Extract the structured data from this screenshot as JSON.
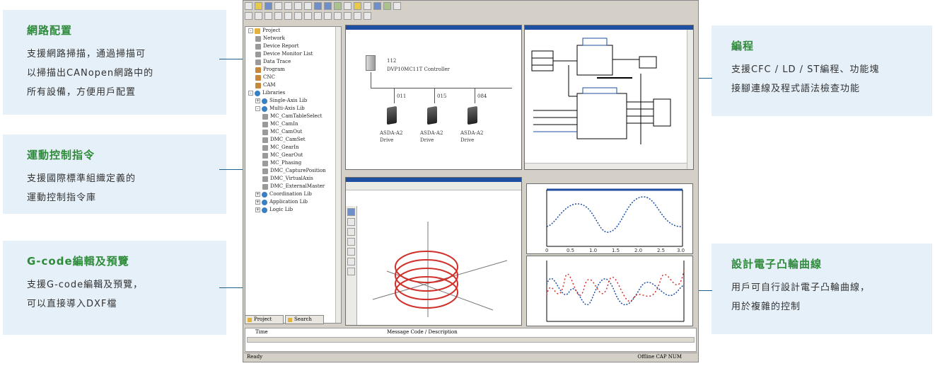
{
  "callouts": {
    "network": {
      "title": "網路配置",
      "lines": [
        "支援網路掃描，通過掃描可",
        "以掃描出CANopen網路中的",
        "所有設備，方便用戶配置"
      ]
    },
    "motion": {
      "title": "運動控制指令",
      "lines": [
        "支援國際標準組織定義的",
        "運動控制指令庫"
      ]
    },
    "gcode": {
      "title": "G-code編輯及預覽",
      "lines": [
        "支援G-code編輯及預覽，",
        "可以直接導入DXF檔"
      ]
    },
    "programming": {
      "title": "編程",
      "lines": [
        "支援CFC / LD / ST編程、功能塊",
        "接腳連線及程式語法檢查功能"
      ]
    },
    "cam": {
      "title": "設計電子凸輪曲線",
      "lines": [
        "用戶可自行設計電子凸輪曲線，",
        "用於複雜的控制"
      ]
    }
  },
  "tree": {
    "items": [
      {
        "label": "Project",
        "icon": "folder-icon",
        "exp": "-"
      },
      {
        "label": "Network",
        "icon": "item-icon"
      },
      {
        "label": "Device Report",
        "icon": "item-icon"
      },
      {
        "label": "Device Monitor List",
        "icon": "item-icon"
      },
      {
        "label": "Data Trace",
        "icon": "item-icon"
      },
      {
        "label": "Program",
        "icon": "program-icon"
      },
      {
        "label": "CNC",
        "icon": "program-icon"
      },
      {
        "label": "CAM",
        "icon": "program-icon"
      },
      {
        "label": "Libraries",
        "icon": "library-icon",
        "exp": "-"
      },
      {
        "label": "Single-Axis Lib",
        "icon": "library-icon",
        "exp": "+"
      },
      {
        "label": "Multi-Axis Lib",
        "icon": "library-icon",
        "exp": "-"
      },
      {
        "label": "MC_CamTableSelect",
        "icon": "item-icon"
      },
      {
        "label": "MC_CamIn",
        "icon": "item-icon"
      },
      {
        "label": "MC_CamOut",
        "icon": "item-icon"
      },
      {
        "label": "DMC_CamSet",
        "icon": "item-icon"
      },
      {
        "label": "MC_GearIn",
        "icon": "item-icon"
      },
      {
        "label": "MC_GearOut",
        "icon": "item-icon"
      },
      {
        "label": "MC_Phasing",
        "icon": "item-icon"
      },
      {
        "label": "DMC_CapturePosition",
        "icon": "item-icon"
      },
      {
        "label": "DMC_VirtualAxis",
        "icon": "item-icon"
      },
      {
        "label": "DMC_ExternalMaster",
        "icon": "item-icon"
      },
      {
        "label": "Coordination Lib",
        "icon": "library-icon",
        "exp": "+"
      },
      {
        "label": "Application Lib",
        "icon": "library-icon",
        "exp": "+"
      },
      {
        "label": "Logic Lib",
        "icon": "library-icon",
        "exp": "+"
      }
    ],
    "tabs": [
      "Project",
      "Search"
    ]
  },
  "network": {
    "controller_id": "112",
    "controller_label": "DVP10MC11T Controller",
    "drives": [
      {
        "id": "011",
        "name": "ASDA-A2",
        "type": "Drive"
      },
      {
        "id": "015",
        "name": "ASDA-A2",
        "type": "Drive"
      },
      {
        "id": "084",
        "name": "ASDA-A2",
        "type": "Drive"
      }
    ]
  },
  "messages": {
    "col1": "Time",
    "col2": "Message Code / Description"
  },
  "status": {
    "left": "Ready",
    "right": "Offline  CAP  NUM"
  },
  "cam_chart": {
    "ticks": [
      "0",
      "0.5",
      "1.0",
      "1.5",
      "2.0",
      "2.5",
      "3.0"
    ]
  }
}
